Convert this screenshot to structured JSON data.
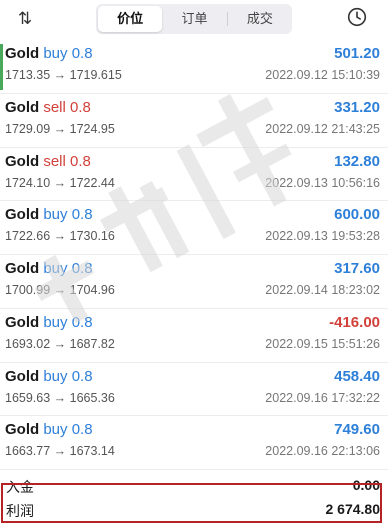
{
  "toolbar": {
    "sort_icon": "sort-icon",
    "tabs": [
      {
        "label": "价位",
        "active": true
      },
      {
        "label": "订单",
        "active": false
      },
      {
        "label": "成交",
        "active": false
      }
    ],
    "history_icon": "clock-icon"
  },
  "deals": [
    {
      "symbol": "Gold",
      "side": "buy",
      "volume": "0.8",
      "prices": "1713.35 → 1719.615",
      "profit": "501.20",
      "time": "2022.09.12 15:10:39"
    },
    {
      "symbol": "Gold",
      "side": "sell",
      "volume": "0.8",
      "prices": "1729.09 → 1724.95",
      "profit": "331.20",
      "time": "2022.09.12 21:43:25"
    },
    {
      "symbol": "Gold",
      "side": "sell",
      "volume": "0.8",
      "prices": "1724.10 → 1722.44",
      "profit": "132.80",
      "time": "2022.09.13 10:56:16"
    },
    {
      "symbol": "Gold",
      "side": "buy",
      "volume": "0.8",
      "prices": "1722.66 → 1730.16",
      "profit": "600.00",
      "time": "2022.09.13 19:53:28"
    },
    {
      "symbol": "Gold",
      "side": "buy",
      "volume": "0.8",
      "prices": "1700.99 → 1704.96",
      "profit": "317.60",
      "time": "2022.09.14 18:23:02"
    },
    {
      "symbol": "Gold",
      "side": "buy",
      "volume": "0.8",
      "prices": "1693.02 → 1687.82",
      "profit": "-416.00",
      "time": "2022.09.15 15:51:26"
    },
    {
      "symbol": "Gold",
      "side": "buy",
      "volume": "0.8",
      "prices": "1659.63 → 1665.36",
      "profit": "458.40",
      "time": "2022.09.16 17:32:22"
    },
    {
      "symbol": "Gold",
      "side": "buy",
      "volume": "0.8",
      "prices": "1663.77 → 1673.14",
      "profit": "749.60",
      "time": "2022.09.16 22:13:06"
    }
  ],
  "summary": {
    "deposit_label": "入金",
    "deposit_value": "0.00",
    "profit_label": "利润",
    "profit_value": "2 674.80"
  },
  "colors": {
    "buy": "#2e7fd8",
    "sell": "#d2403a",
    "positive": "#2e7fd8",
    "negative": "#d2403a",
    "highlight_box": "#b52424"
  }
}
